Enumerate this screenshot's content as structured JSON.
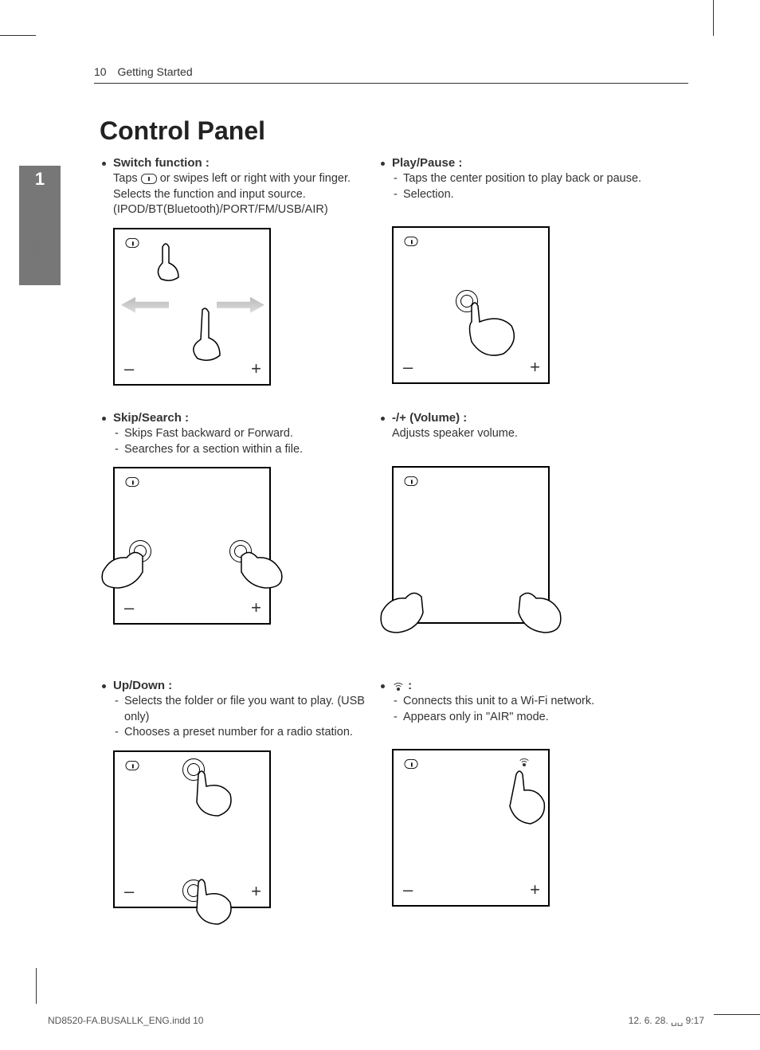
{
  "header": {
    "page_number": "10",
    "section": "Getting Started"
  },
  "sidetab": {
    "chapter_number": "1",
    "label": "Getting Started"
  },
  "title": "Control Panel",
  "items": {
    "switch": {
      "head": "Switch function :",
      "desc_pre": "Taps ",
      "desc_post": " or swipes left or right with your finger.",
      "line2": "Selects the function and input source.",
      "line3": "(IPOD/BT(Bluetooth)/PORT/FM/USB/AIR)"
    },
    "play": {
      "head": "Play/Pause :",
      "li1": "Taps the center position to play back or pause.",
      "li2": "Selection."
    },
    "skip": {
      "head": "Skip/Search :",
      "li1": "Skips Fast backward or Forward.",
      "li2": "Searches for a section within a file."
    },
    "volume": {
      "head": "-/+ (Volume) :",
      "desc": "Adjusts speaker volume."
    },
    "updown": {
      "head": "Up/Down :",
      "li1": "Selects the folder or file you want to play. (USB only)",
      "li2": "Chooses a preset number for a radio station."
    },
    "wifi": {
      "head_suffix": " :",
      "li1": "Connects this unit to a Wi-Fi network.",
      "li2": "Appears only in \"AIR\" mode."
    }
  },
  "footer": {
    "file": "ND8520-FA.BUSALLK_ENG.indd   10",
    "date": "12. 6. 28.   ␣␣ 9:17"
  },
  "glyphs": {
    "minus": "–",
    "plus": "+"
  }
}
